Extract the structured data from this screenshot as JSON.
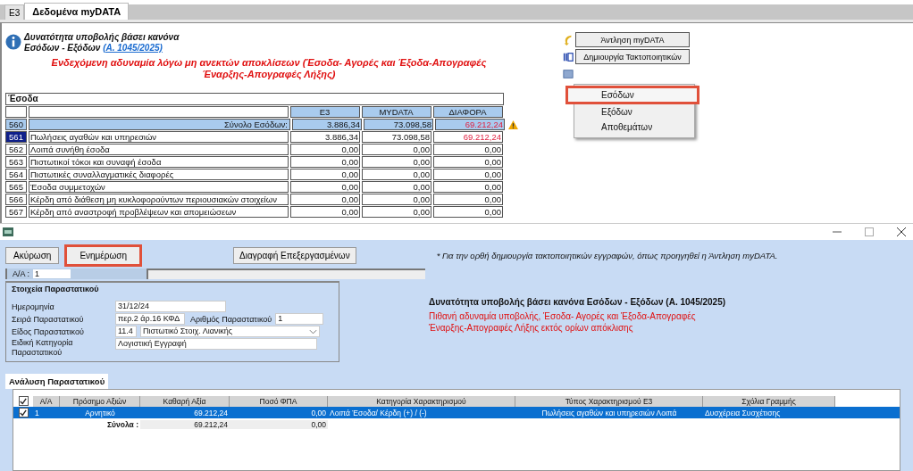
{
  "tabs": [
    {
      "label": "E3",
      "selected": false
    },
    {
      "label": "Δεδομένα myDATA",
      "selected": true
    }
  ],
  "info": {
    "line1": "Δυνατότητα υποβολής βάσει κανόνα",
    "line2": "Εσόδων - Εξόδων",
    "link": "(Α. 1045/2025)",
    "warning_lines": [
      "Ενδεχόμενη αδυναμία λόγω μη ανεκτών αποκλίσεων (Έσοδα- Αγορές και Έξοδα-Απογραφές",
      "Έναρξης-Απογραφές Λήξης)"
    ]
  },
  "actions": [
    {
      "label": "Άντληση myDATA",
      "kind": "fetch"
    },
    {
      "label": "Δημιουργία Τακτοποιητικών",
      "kind": "create"
    }
  ],
  "menu": [
    {
      "label": "Εσόδων",
      "highlighted": true
    },
    {
      "label": "Εξόδων",
      "highlighted": false
    },
    {
      "label": "Αποθεμάτων",
      "highlighted": false
    }
  ],
  "income_table": {
    "title": "Έσοδα",
    "columns": [
      "Ε3",
      "MYDATA",
      "ΔΙΑΦΟΡΑ"
    ],
    "rows": [
      {
        "code": "560",
        "label": "Σύνολο Εσόδων:",
        "kind": "total",
        "selected": false,
        "values": [
          "3.886,34",
          "73.098,58",
          "69.212,24"
        ],
        "diff_flagged": true,
        "warning": true
      },
      {
        "code": "561",
        "label": "Πωλήσεις αγαθών και υπηρεσιών",
        "kind": "line",
        "selected": true,
        "values": [
          "3.886,34",
          "73.098,58",
          "69.212,24"
        ],
        "diff_flagged": true,
        "warning": false
      },
      {
        "code": "562",
        "label": "Λοιπά συνήθη έσοδα",
        "kind": "line",
        "selected": false,
        "values": [
          "0,00",
          "0,00",
          "0,00"
        ],
        "diff_flagged": false,
        "warning": false
      },
      {
        "code": "563",
        "label": "Πιστωτικοί τόκοι και συναφή έσοδα",
        "kind": "line",
        "selected": false,
        "values": [
          "0,00",
          "0,00",
          "0,00"
        ],
        "diff_flagged": false,
        "warning": false
      },
      {
        "code": "564",
        "label": "Πιστωτικές συναλλαγματικές διαφορές",
        "kind": "line",
        "selected": false,
        "values": [
          "0,00",
          "0,00",
          "0,00"
        ],
        "diff_flagged": false,
        "warning": false
      },
      {
        "code": "565",
        "label": "Έσοδα συμμετοχών",
        "kind": "line",
        "selected": false,
        "values": [
          "0,00",
          "0,00",
          "0,00"
        ],
        "diff_flagged": false,
        "warning": false
      },
      {
        "code": "566",
        "label": "Κέρδη από διάθεση μη κυκλοφορούντων περιουσιακών στοιχείων",
        "kind": "line",
        "selected": false,
        "values": [
          "0,00",
          "0,00",
          "0,00"
        ],
        "diff_flagged": false,
        "warning": false
      },
      {
        "code": "567",
        "label": "Κέρδη από αναστροφή προβλέψεων και απομειώσεων",
        "kind": "line",
        "selected": false,
        "values": [
          "0,00",
          "0,00",
          "0,00"
        ],
        "diff_flagged": false,
        "warning": false
      }
    ]
  },
  "dialog": {
    "buttons": [
      {
        "label": "Ακύρωση",
        "highlighted": false
      },
      {
        "label": "Ενημέρωση",
        "highlighted": true
      }
    ],
    "delete_button": "Διαγραφή Επεξεργασμένων",
    "note": "* Για την ορθή δημιουργία τακτοποιητικών εγγραφών, όπως προηγηθεί η Άντληση myDATA.",
    "aa_label": "Α/Α :",
    "aa_value": "1",
    "section_title": "Στοιχεία Παραστατικού",
    "date_label": "Ημερομηνία",
    "date_value": "31/12/24",
    "series_label": "Σειρά Παραστατικού",
    "series_value": "περ.2 άρ.16 ΚΦΔ",
    "number_label": "Αριθμός Παραστατικού",
    "number_value": "1",
    "type_label": "Είδος Παραστατικού",
    "type_code": "11.4",
    "type_value": "Πιστωτικό Στοιχ. Λιανικής",
    "category_label": "Ειδική Κατηγορία Παραστατικού",
    "category_value": "Λογιστική Εγγραφή",
    "rule_title": "Δυνατότητα υποβολής βάσει κανόνα Εσόδων - Εξόδων (Α. 1045/2025)",
    "rule_warning_lines": [
      "Πιθανή αδυναμία υποβολής, Έσοδα- Αγορές και Έξοδα-Απογραφές",
      "Έναρξης-Απογραφές Λήξης εκτός ορίων απόκλισης"
    ],
    "analysis_tab": "Ανάλυση Παραστατικού",
    "grid": {
      "all_checked": true,
      "columns": [
        "Α/Α",
        "Πρόσημο Αξιών",
        "Καθαρή Αξία",
        "Ποσό ΦΠΑ",
        "Κατηγορία Χαρακτηρισμού",
        "Τύπος Χαρακτηρισμού Ε3",
        "Σχόλια Γραμμής"
      ],
      "rows": [
        {
          "checked": true,
          "selected": true,
          "cells": [
            "1",
            "Αρνητικό",
            "69.212,24",
            "0,00",
            "Λοιπά Έσοδα/ Κέρδη (+) / (-)",
            "Πωλήσεις αγαθών και υπηρεσιών Λοιπά",
            "Δυσχέρεια Συσχέτισης"
          ]
        }
      ],
      "totals_label": "Σύνολα :",
      "totals": [
        "69.212,24",
        "0,00"
      ]
    }
  }
}
